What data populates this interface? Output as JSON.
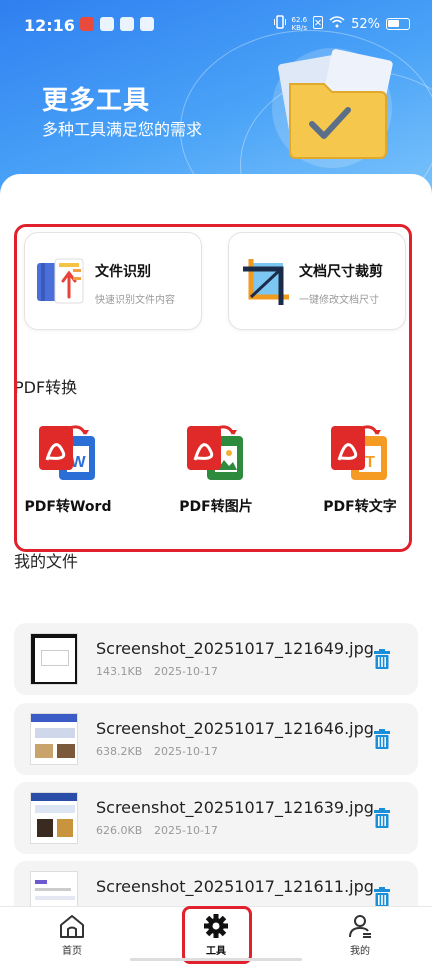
{
  "status_bar": {
    "time": "12:16",
    "net_speed_value": "62.6",
    "net_speed_unit": "KB/s",
    "battery": "52%"
  },
  "header": {
    "title": "更多工具",
    "subtitle": "多种工具满足您的需求"
  },
  "tools": [
    {
      "title": "文件识别",
      "desc": "快速识别文件内容",
      "icon": "file-recognize-icon"
    },
    {
      "title": "文档尺寸裁剪",
      "desc": "一键修改文档尺寸",
      "icon": "crop-icon"
    }
  ],
  "pdf_section": {
    "title": "PDF转换",
    "items": [
      {
        "label": "PDF转Word",
        "icon": "pdf-to-word-icon",
        "accent": "#2b6fd6"
      },
      {
        "label": "PDF转图片",
        "icon": "pdf-to-image-icon",
        "accent": "#2e8b3e"
      },
      {
        "label": "PDF转文字",
        "icon": "pdf-to-text-icon",
        "accent": "#f59a23"
      }
    ]
  },
  "files_section": {
    "title": "我的文件",
    "files": [
      {
        "name": "Screenshot_20251017_121649.jpg",
        "size": "143.1KB",
        "date": "2025-10-17"
      },
      {
        "name": "Screenshot_20251017_121646.jpg",
        "size": "638.2KB",
        "date": "2025-10-17"
      },
      {
        "name": "Screenshot_20251017_121639.jpg",
        "size": "626.0KB",
        "date": "2025-10-17"
      },
      {
        "name": "Screenshot_20251017_121611.jpg",
        "size": "",
        "date": ""
      }
    ]
  },
  "bottom_nav": [
    {
      "label": "首页",
      "icon": "home-icon"
    },
    {
      "label": "工具",
      "icon": "gear-icon",
      "active": true
    },
    {
      "label": "我的",
      "icon": "user-icon"
    }
  ],
  "colors": {
    "header_gradient_start": "#2f7ff0",
    "header_gradient_end": "#7cc4fb",
    "highlight": "#e0202c",
    "pdf_red": "#e02a2a",
    "delete_blue": "#1a8fd8",
    "file_card_bg": "#f4f4f5"
  }
}
